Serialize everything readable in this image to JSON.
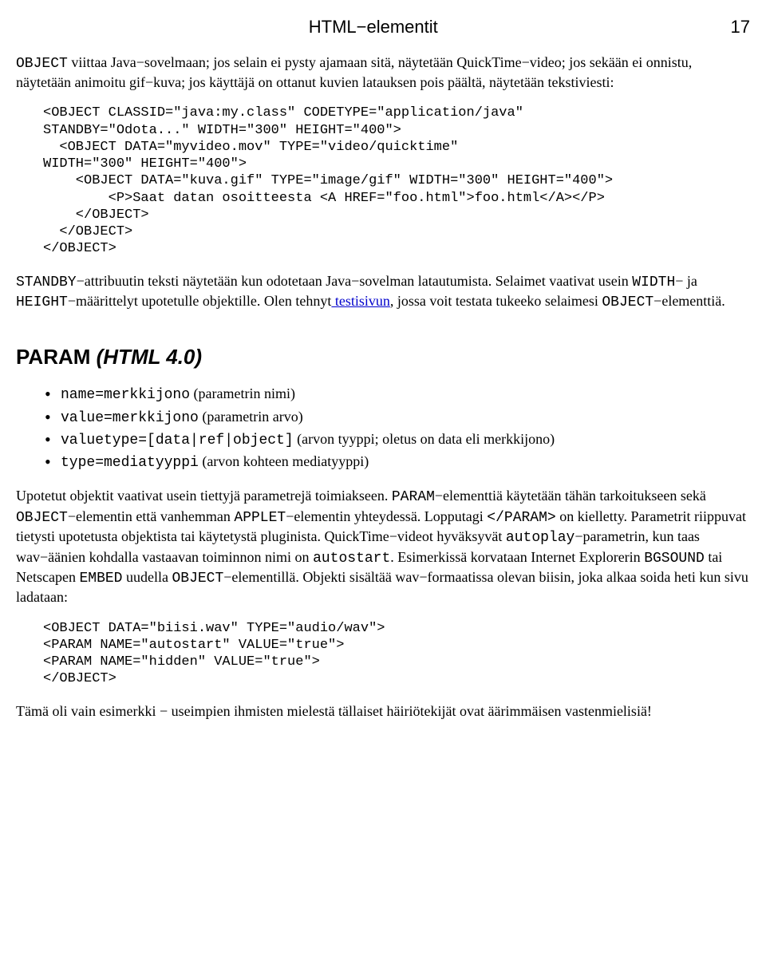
{
  "header": {
    "title": "HTML−elementit",
    "page": "17"
  },
  "intro": {
    "t1a": "OBJECT",
    "t1b": " viittaa Java−sovelmaan; jos selain ei pysty ajamaan sitä, näytetään QuickTime−video; jos sekään ei onnistu, näytetään animoitu gif−kuva; jos käyttäjä on ottanut kuvien latauksen pois päältä, näytetään tekstiviesti:"
  },
  "code1": "<OBJECT CLASSID=\"java:my.class\" CODETYPE=\"application/java\"\nSTANDBY=\"Odota...\" WIDTH=\"300\" HEIGHT=\"400\">\n  <OBJECT DATA=\"myvideo.mov\" TYPE=\"video/quicktime\"\nWIDTH=\"300\" HEIGHT=\"400\">\n    <OBJECT DATA=\"kuva.gif\" TYPE=\"image/gif\" WIDTH=\"300\" HEIGHT=\"400\">\n        <P>Saat datan osoitteesta <A HREF=\"foo.html\">foo.html</A></P>\n    </OBJECT>\n  </OBJECT>\n</OBJECT>",
  "standby": {
    "s1": "STANDBY",
    "s2": "−attribuutin teksti näytetään kun odotetaan Java−sovelman latautumista. Selaimet vaativat usein ",
    "s3": "WIDTH",
    "s4": "− ja ",
    "s5": "HEIGHT",
    "s6": "−määrittelyt upotetulle objektille. Olen tehnyt",
    "link": " testisivun",
    "s7": ", jossa voit testata tukeeko selaimesi ",
    "s8": "OBJECT",
    "s9": "−elementtiä."
  },
  "section": {
    "title1": "PARAM ",
    "title2": "(HTML 4.0)"
  },
  "params": {
    "i1a": "name=merkkijono",
    "i1b": " (parametrin nimi)",
    "i2a": "value=merkkijono",
    "i2b": " (parametrin arvo)",
    "i3a": "valuetype=[data|ref|object]",
    "i3b": " (arvon tyyppi; oletus on data eli merkkijono)",
    "i4a": "type=mediatyyppi",
    "i4b": " (arvon kohteen mediatyyppi)"
  },
  "paramtext": {
    "p1": "Upotetut objektit vaativat usein tiettyjä parametrejä toimiakseen. ",
    "p2": "PARAM",
    "p3": "−elementtiä käytetään tähän tarkoitukseen sekä ",
    "p4": "OBJECT",
    "p5": "−elementin että vanhemman ",
    "p6": "APPLET",
    "p7": "−elementin yhteydessä. Lopputagi ",
    "p8": "</PARAM>",
    "p9": " on kielletty. Parametrit riippuvat tietysti upotetusta objektista tai käytetystä pluginista. QuickTime−videot hyväksyvät ",
    "p10": "autoplay",
    "p11": "−parametrin, kun taas wav−äänien kohdalla vastaavan toiminnon nimi on ",
    "p12": "autostart",
    "p13": ". Esimerkissä korvataan Internet Explorerin ",
    "p14": "BGSOUND",
    "p15": " tai Netscapen ",
    "p16": "EMBED",
    "p17": " uudella ",
    "p18": "OBJECT",
    "p19": "−elementillä. Objekti sisältää wav−formaatissa olevan biisin, joka alkaa soida heti kun sivu ladataan:"
  },
  "code2": "<OBJECT DATA=\"biisi.wav\" TYPE=\"audio/wav\">\n<PARAM NAME=\"autostart\" VALUE=\"true\">\n<PARAM NAME=\"hidden\" VALUE=\"true\">\n</OBJECT>",
  "outro": "Tämä oli vain esimerkki − useimpien ihmisten mielestä tällaiset häiriötekijät ovat äärimmäisen vastenmielisiä!"
}
